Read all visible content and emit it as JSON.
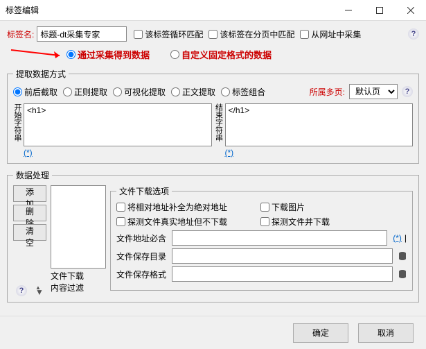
{
  "title": "标签编辑",
  "top": {
    "tagname_label": "标签名:",
    "tagname_value": "标题-dt采集专家",
    "loop_match": "该标签循环匹配",
    "page_match": "该标签在分页中匹配",
    "url_collect": "从网址中采集"
  },
  "mode": {
    "collect": "通过采集得到数据",
    "custom": "自定义固定格式的数据"
  },
  "extract": {
    "legend": "提取数据方式",
    "m1": "前后截取",
    "m2": "正则提取",
    "m3": "可视化提取",
    "m4": "正文提取",
    "m5": "标签组合",
    "belong_label": "所属多页:",
    "belong_value": "默认页",
    "start_label": "开始字符串",
    "start_value": "<h1>",
    "end_label": "结束字符串",
    "end_value": "</h1>",
    "wildcard": "(*)"
  },
  "proc": {
    "legend": "数据处理",
    "add": "添加",
    "del": "删除",
    "clear": "清空",
    "file_download": "文件下载",
    "content_filter": "内容过滤",
    "fileopt": {
      "legend": "文件下载选项",
      "c1": "将相对地址补全为绝对地址",
      "c2": "下载图片",
      "c3": "探测文件真实地址但不下载",
      "c4": "探测文件并下载",
      "f1": "文件地址必含",
      "f2": "文件保存目录",
      "f3": "文件保存格式",
      "wildcard": "(*)",
      "pipe": "|"
    }
  },
  "footer": {
    "ok": "确定",
    "cancel": "取消"
  }
}
